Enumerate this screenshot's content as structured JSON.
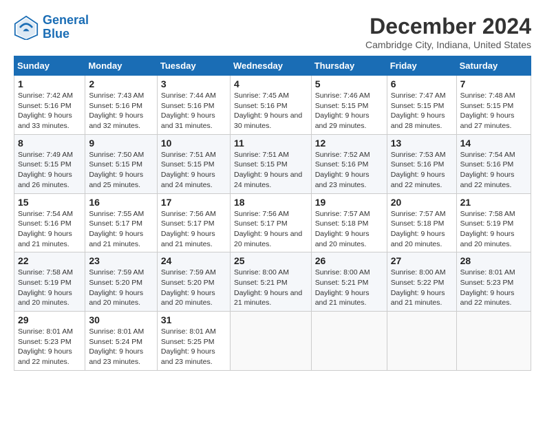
{
  "logo": {
    "line1": "General",
    "line2": "Blue"
  },
  "title": "December 2024",
  "location": "Cambridge City, Indiana, United States",
  "headers": [
    "Sunday",
    "Monday",
    "Tuesday",
    "Wednesday",
    "Thursday",
    "Friday",
    "Saturday"
  ],
  "weeks": [
    [
      {
        "day": "1",
        "sunrise": "7:42 AM",
        "sunset": "5:16 PM",
        "daylight": "9 hours and 33 minutes."
      },
      {
        "day": "2",
        "sunrise": "7:43 AM",
        "sunset": "5:16 PM",
        "daylight": "9 hours and 32 minutes."
      },
      {
        "day": "3",
        "sunrise": "7:44 AM",
        "sunset": "5:16 PM",
        "daylight": "9 hours and 31 minutes."
      },
      {
        "day": "4",
        "sunrise": "7:45 AM",
        "sunset": "5:16 PM",
        "daylight": "9 hours and 30 minutes."
      },
      {
        "day": "5",
        "sunrise": "7:46 AM",
        "sunset": "5:15 PM",
        "daylight": "9 hours and 29 minutes."
      },
      {
        "day": "6",
        "sunrise": "7:47 AM",
        "sunset": "5:15 PM",
        "daylight": "9 hours and 28 minutes."
      },
      {
        "day": "7",
        "sunrise": "7:48 AM",
        "sunset": "5:15 PM",
        "daylight": "9 hours and 27 minutes."
      }
    ],
    [
      {
        "day": "8",
        "sunrise": "7:49 AM",
        "sunset": "5:15 PM",
        "daylight": "9 hours and 26 minutes."
      },
      {
        "day": "9",
        "sunrise": "7:50 AM",
        "sunset": "5:15 PM",
        "daylight": "9 hours and 25 minutes."
      },
      {
        "day": "10",
        "sunrise": "7:51 AM",
        "sunset": "5:15 PM",
        "daylight": "9 hours and 24 minutes."
      },
      {
        "day": "11",
        "sunrise": "7:51 AM",
        "sunset": "5:15 PM",
        "daylight": "9 hours and 24 minutes."
      },
      {
        "day": "12",
        "sunrise": "7:52 AM",
        "sunset": "5:16 PM",
        "daylight": "9 hours and 23 minutes."
      },
      {
        "day": "13",
        "sunrise": "7:53 AM",
        "sunset": "5:16 PM",
        "daylight": "9 hours and 22 minutes."
      },
      {
        "day": "14",
        "sunrise": "7:54 AM",
        "sunset": "5:16 PM",
        "daylight": "9 hours and 22 minutes."
      }
    ],
    [
      {
        "day": "15",
        "sunrise": "7:54 AM",
        "sunset": "5:16 PM",
        "daylight": "9 hours and 21 minutes."
      },
      {
        "day": "16",
        "sunrise": "7:55 AM",
        "sunset": "5:17 PM",
        "daylight": "9 hours and 21 minutes."
      },
      {
        "day": "17",
        "sunrise": "7:56 AM",
        "sunset": "5:17 PM",
        "daylight": "9 hours and 21 minutes."
      },
      {
        "day": "18",
        "sunrise": "7:56 AM",
        "sunset": "5:17 PM",
        "daylight": "9 hours and 20 minutes."
      },
      {
        "day": "19",
        "sunrise": "7:57 AM",
        "sunset": "5:18 PM",
        "daylight": "9 hours and 20 minutes."
      },
      {
        "day": "20",
        "sunrise": "7:57 AM",
        "sunset": "5:18 PM",
        "daylight": "9 hours and 20 minutes."
      },
      {
        "day": "21",
        "sunrise": "7:58 AM",
        "sunset": "5:19 PM",
        "daylight": "9 hours and 20 minutes."
      }
    ],
    [
      {
        "day": "22",
        "sunrise": "7:58 AM",
        "sunset": "5:19 PM",
        "daylight": "9 hours and 20 minutes."
      },
      {
        "day": "23",
        "sunrise": "7:59 AM",
        "sunset": "5:20 PM",
        "daylight": "9 hours and 20 minutes."
      },
      {
        "day": "24",
        "sunrise": "7:59 AM",
        "sunset": "5:20 PM",
        "daylight": "9 hours and 20 minutes."
      },
      {
        "day": "25",
        "sunrise": "8:00 AM",
        "sunset": "5:21 PM",
        "daylight": "9 hours and 21 minutes."
      },
      {
        "day": "26",
        "sunrise": "8:00 AM",
        "sunset": "5:21 PM",
        "daylight": "9 hours and 21 minutes."
      },
      {
        "day": "27",
        "sunrise": "8:00 AM",
        "sunset": "5:22 PM",
        "daylight": "9 hours and 21 minutes."
      },
      {
        "day": "28",
        "sunrise": "8:01 AM",
        "sunset": "5:23 PM",
        "daylight": "9 hours and 22 minutes."
      }
    ],
    [
      {
        "day": "29",
        "sunrise": "8:01 AM",
        "sunset": "5:23 PM",
        "daylight": "9 hours and 22 minutes."
      },
      {
        "day": "30",
        "sunrise": "8:01 AM",
        "sunset": "5:24 PM",
        "daylight": "9 hours and 23 minutes."
      },
      {
        "day": "31",
        "sunrise": "8:01 AM",
        "sunset": "5:25 PM",
        "daylight": "9 hours and 23 minutes."
      },
      null,
      null,
      null,
      null
    ]
  ]
}
